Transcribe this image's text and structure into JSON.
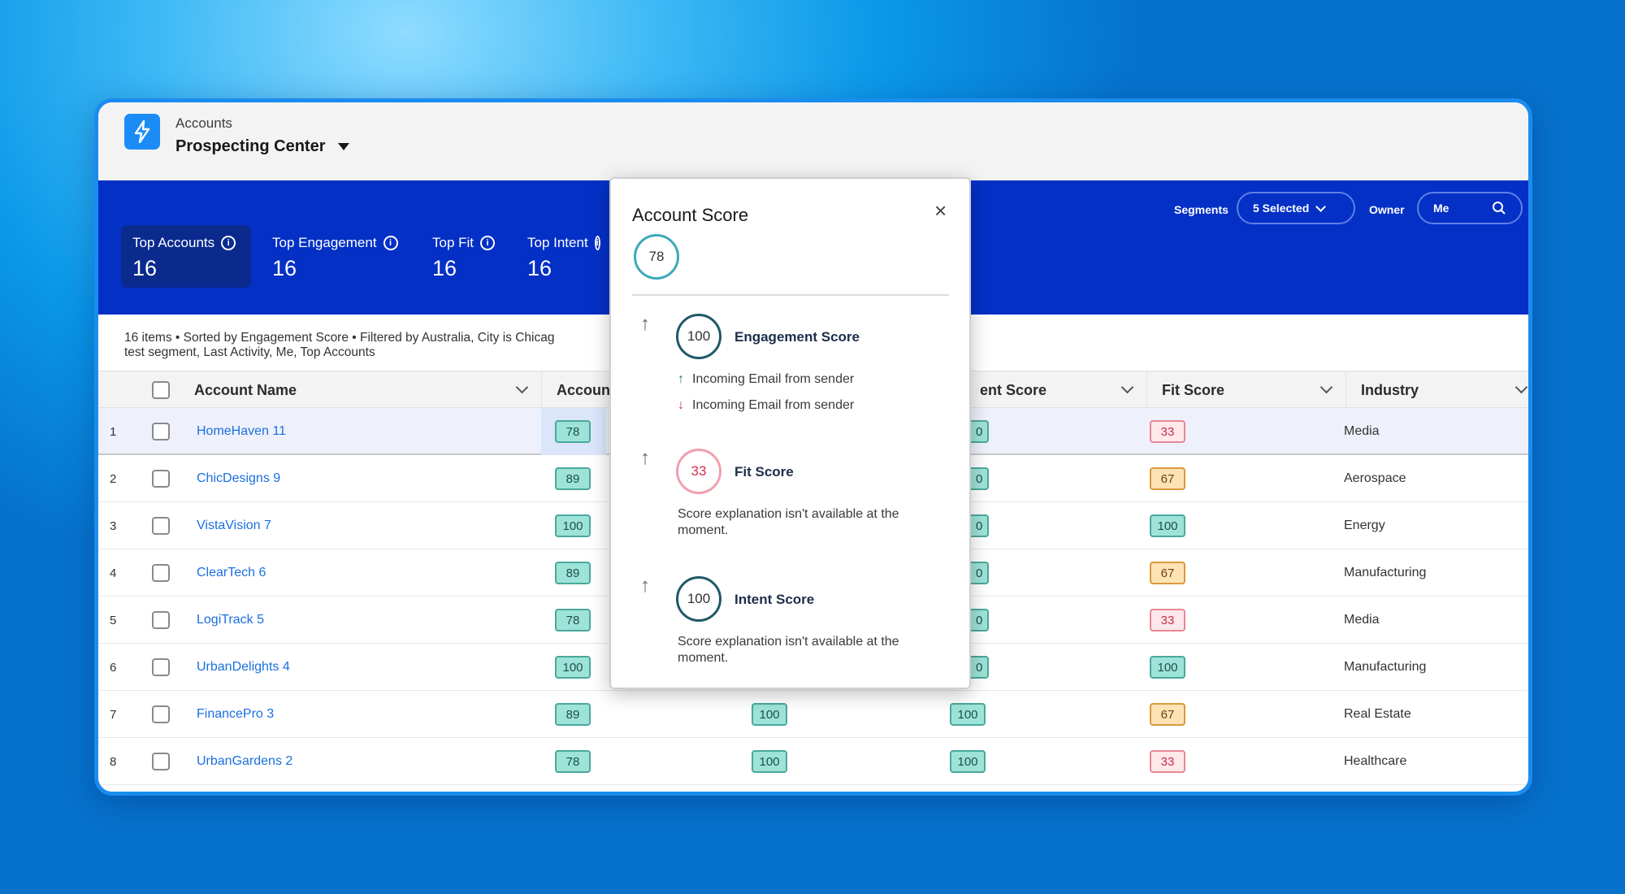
{
  "header": {
    "breadcrumb": "Accounts",
    "title": "Prospecting Center"
  },
  "tabs": [
    {
      "label": "Top Accounts",
      "count": "16"
    },
    {
      "label": "Top Engagement",
      "count": "16"
    },
    {
      "label": "Top Fit",
      "count": "16"
    },
    {
      "label": "Top Intent",
      "count": "16"
    }
  ],
  "filters": {
    "segments_label": "Segments",
    "segments_value": "5 Selected",
    "owner_label": "Owner",
    "owner_value": "Me"
  },
  "list_info": {
    "line1": "16 items • Sorted by Engagement Score • Filtered by Australia, City is Chicag",
    "line2": "test segment, Last Activity, Me, Top Accounts"
  },
  "columns": {
    "account_name": "Account Name",
    "account_score": "Accoun",
    "intent_score": "ent Score",
    "fit_score": "Fit Score",
    "industry": "Industry"
  },
  "rows": [
    {
      "num": "1",
      "name": "HomeHaven 11",
      "account": "78",
      "engagement": "",
      "intent": "0",
      "fit": "33",
      "fit_color": "red",
      "industry": "Media"
    },
    {
      "num": "2",
      "name": "ChicDesigns 9",
      "account": "89",
      "engagement": "",
      "intent": "0",
      "fit": "67",
      "fit_color": "orange",
      "industry": "Aerospace"
    },
    {
      "num": "3",
      "name": "VistaVision 7",
      "account": "100",
      "engagement": "",
      "intent": "0",
      "fit": "100",
      "fit_color": "teal",
      "industry": "Energy"
    },
    {
      "num": "4",
      "name": "ClearTech 6",
      "account": "89",
      "engagement": "",
      "intent": "0",
      "fit": "67",
      "fit_color": "orange",
      "industry": "Manufacturing"
    },
    {
      "num": "5",
      "name": "LogiTrack 5",
      "account": "78",
      "engagement": "",
      "intent": "0",
      "fit": "33",
      "fit_color": "red",
      "industry": "Media"
    },
    {
      "num": "6",
      "name": "UrbanDelights 4",
      "account": "100",
      "engagement": "",
      "intent": "0",
      "fit": "100",
      "fit_color": "teal",
      "industry": "Manufacturing"
    },
    {
      "num": "7",
      "name": "FinancePro 3",
      "account": "89",
      "engagement": "100",
      "intent": "100",
      "fit": "67",
      "fit_color": "orange",
      "industry": "Real Estate"
    },
    {
      "num": "8",
      "name": "UrbanGardens 2",
      "account": "78",
      "engagement": "100",
      "intent": "100",
      "fit": "33",
      "fit_color": "red",
      "industry": "Healthcare"
    }
  ],
  "popover": {
    "title": "Account Score",
    "close": "×",
    "overall": "78",
    "engagement": {
      "score": "100",
      "label": "Engagement Score",
      "reason_up": "Incoming Email from sender",
      "reason_down": "Incoming Email from sender"
    },
    "fit": {
      "score": "33",
      "label": "Fit Score",
      "note": "Score explanation isn't available at the moment."
    },
    "intent": {
      "score": "100",
      "label": "Intent Score",
      "note": "Score explanation isn't available at the moment."
    },
    "expand_glyph": "↑"
  },
  "colors": {
    "band": "#0430c6",
    "brand": "#1b8cf5",
    "link": "#1b6fe0"
  }
}
